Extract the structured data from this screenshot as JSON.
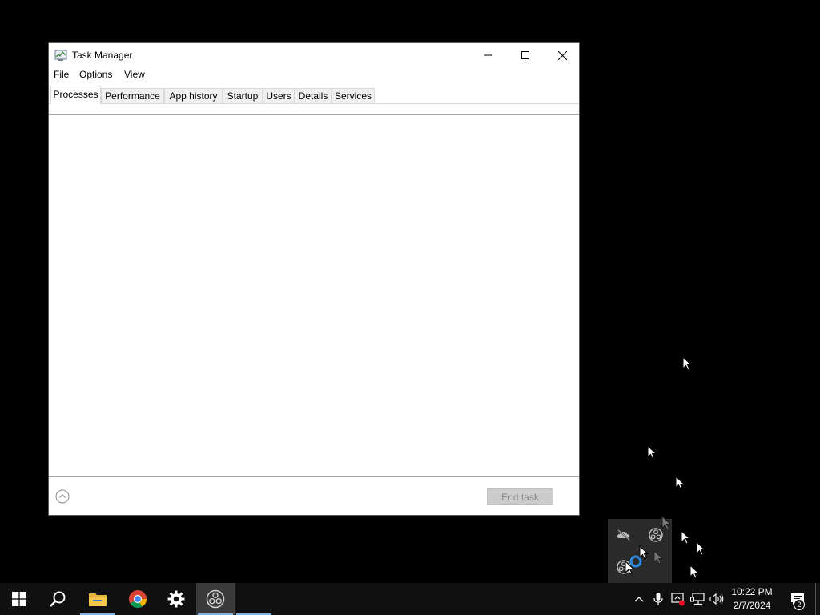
{
  "window": {
    "title": "Task Manager",
    "controls": {
      "minimize": "minimize",
      "maximize": "maximize",
      "close": "close"
    }
  },
  "menu": [
    "File",
    "Options",
    "View"
  ],
  "tabs": [
    {
      "label": "Processes",
      "active": true
    },
    {
      "label": "Performance",
      "active": false
    },
    {
      "label": "App history",
      "active": false
    },
    {
      "label": "Startup",
      "active": false
    },
    {
      "label": "Users",
      "active": false
    },
    {
      "label": "Details",
      "active": false
    },
    {
      "label": "Services",
      "active": false
    }
  ],
  "footer": {
    "end_task_label": "End task",
    "end_task_enabled": false
  },
  "taskbar": {
    "pinned": [
      "start-icon",
      "search-icon",
      "file-explorer-icon",
      "chrome-icon",
      "settings-icon",
      "obs-icon"
    ],
    "clock": {
      "time": "10:22 PM",
      "date": "2/7/2024"
    },
    "notification_count": "2"
  },
  "colors": {
    "accent": "#7fb2e5",
    "taskbar": "#101010",
    "desktop": "#000000"
  }
}
